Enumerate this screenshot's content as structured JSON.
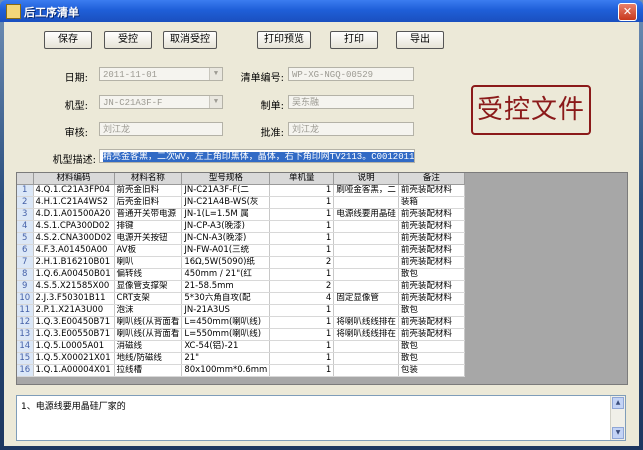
{
  "window": {
    "title": "后工序清单",
    "close_glyph": "✕"
  },
  "toolbar": {
    "save": "保存",
    "control": "受控",
    "uncontrol": "取消受控",
    "print_preview": "打印预览",
    "print": "打印",
    "export": "导出"
  },
  "form": {
    "date_label": "日期:",
    "date_value": "2011-11-01",
    "list_no_label": "清单编号:",
    "list_no_value": "WP-XG-NGQ-00529",
    "model_label": "机型:",
    "model_value": "JN-C21A3F-F",
    "maker_label": "制单:",
    "maker_value": "吴东融",
    "review_label": "审核:",
    "review_value": "刘江龙",
    "approve_label": "批准:",
    "approve_value": "刘江龙",
    "desc_label": "机型描述:",
    "desc_value": "精亮金客黑，二次WV，左上角印黑体，晶体，右下角印网TV2113。C001201103I-037"
  },
  "stamp": {
    "text": "受控文件"
  },
  "grid": {
    "columns": [
      "",
      "材料编码",
      "材料名称",
      "型号规格",
      "单机量",
      "说明",
      "备注"
    ],
    "rows": [
      [
        "1",
        "4.Q.1.C21A3FP04",
        "前壳金旧料",
        "JN-C21A3F-F(二",
        "1",
        "刷哑金客黑，二",
        "前壳装配材料"
      ],
      [
        "2",
        "4.H.1.C21A4WS2",
        "后壳金旧料",
        "JN-C21A4B-WS(灰",
        "1",
        "",
        "装箱"
      ],
      [
        "3",
        "4.D.1.A01500A20",
        "普通开关带电源",
        "JN-1(L=1.5M 属",
        "1",
        "电源线要用晶硅",
        "前壳装配材料"
      ],
      [
        "4",
        "4.S.1.CPA300D02",
        "排键",
        "JN-CP-A3(晚漆)",
        "1",
        "",
        "前壳装配材料"
      ],
      [
        "5",
        "4.S.2.CNA300D02",
        "电源开关按钮",
        "JN-CN-A3(晚漆)",
        "1",
        "",
        "前壳装配材料"
      ],
      [
        "6",
        "4.F.3.A01450A00",
        "AV板",
        "JN-FW-A01(三统",
        "1",
        "",
        "前壳装配材料"
      ],
      [
        "7",
        "2.H.1.B16210B01",
        "喇叭",
        "16Ω,5W(5090)纸",
        "2",
        "",
        "前壳装配材料"
      ],
      [
        "8",
        "1.Q.6.A00450B01",
        "偏转线",
        "450mm / 21\"(红",
        "1",
        "",
        "散包"
      ],
      [
        "9",
        "4.S.5.X21585X00",
        "显像管支撑架",
        "21-58.5mm",
        "2",
        "",
        "前壳装配材料"
      ],
      [
        "10",
        "2.J.3.F50301B11",
        "CRT支架",
        "5*30六角自攻(配",
        "4",
        "固定显像管",
        "前壳装配材料"
      ],
      [
        "11",
        "2.P.1.X21A3U00",
        "泡沫",
        "JN-21A3US",
        "1",
        "",
        "散包"
      ],
      [
        "12",
        "1.Q.3.E00450B71",
        "喇叭线(从背面看",
        "L=450mm(喇叭线)",
        "1",
        "将喇叭线线排在",
        "前壳装配材料"
      ],
      [
        "13",
        "1.Q.3.E00550B71",
        "喇叭线(从背面看",
        "L=550mm(喇叭线)",
        "1",
        "将喇叭线线排在",
        "前壳装配材料"
      ],
      [
        "14",
        "1.Q.5.L0005A01",
        "消磁线",
        "XC-54(铝)-21",
        "1",
        "",
        "散包"
      ],
      [
        "15",
        "1.Q.5.X00021X01",
        "地线/防磁线",
        "21\"",
        "1",
        "",
        "散包"
      ],
      [
        "16",
        "1.Q.1.A00004X01",
        "拉线槽",
        "80x100mm*0.6mm",
        "1",
        "",
        "包装"
      ]
    ]
  },
  "note": {
    "text": "1、电源线要用晶硅厂家的"
  }
}
